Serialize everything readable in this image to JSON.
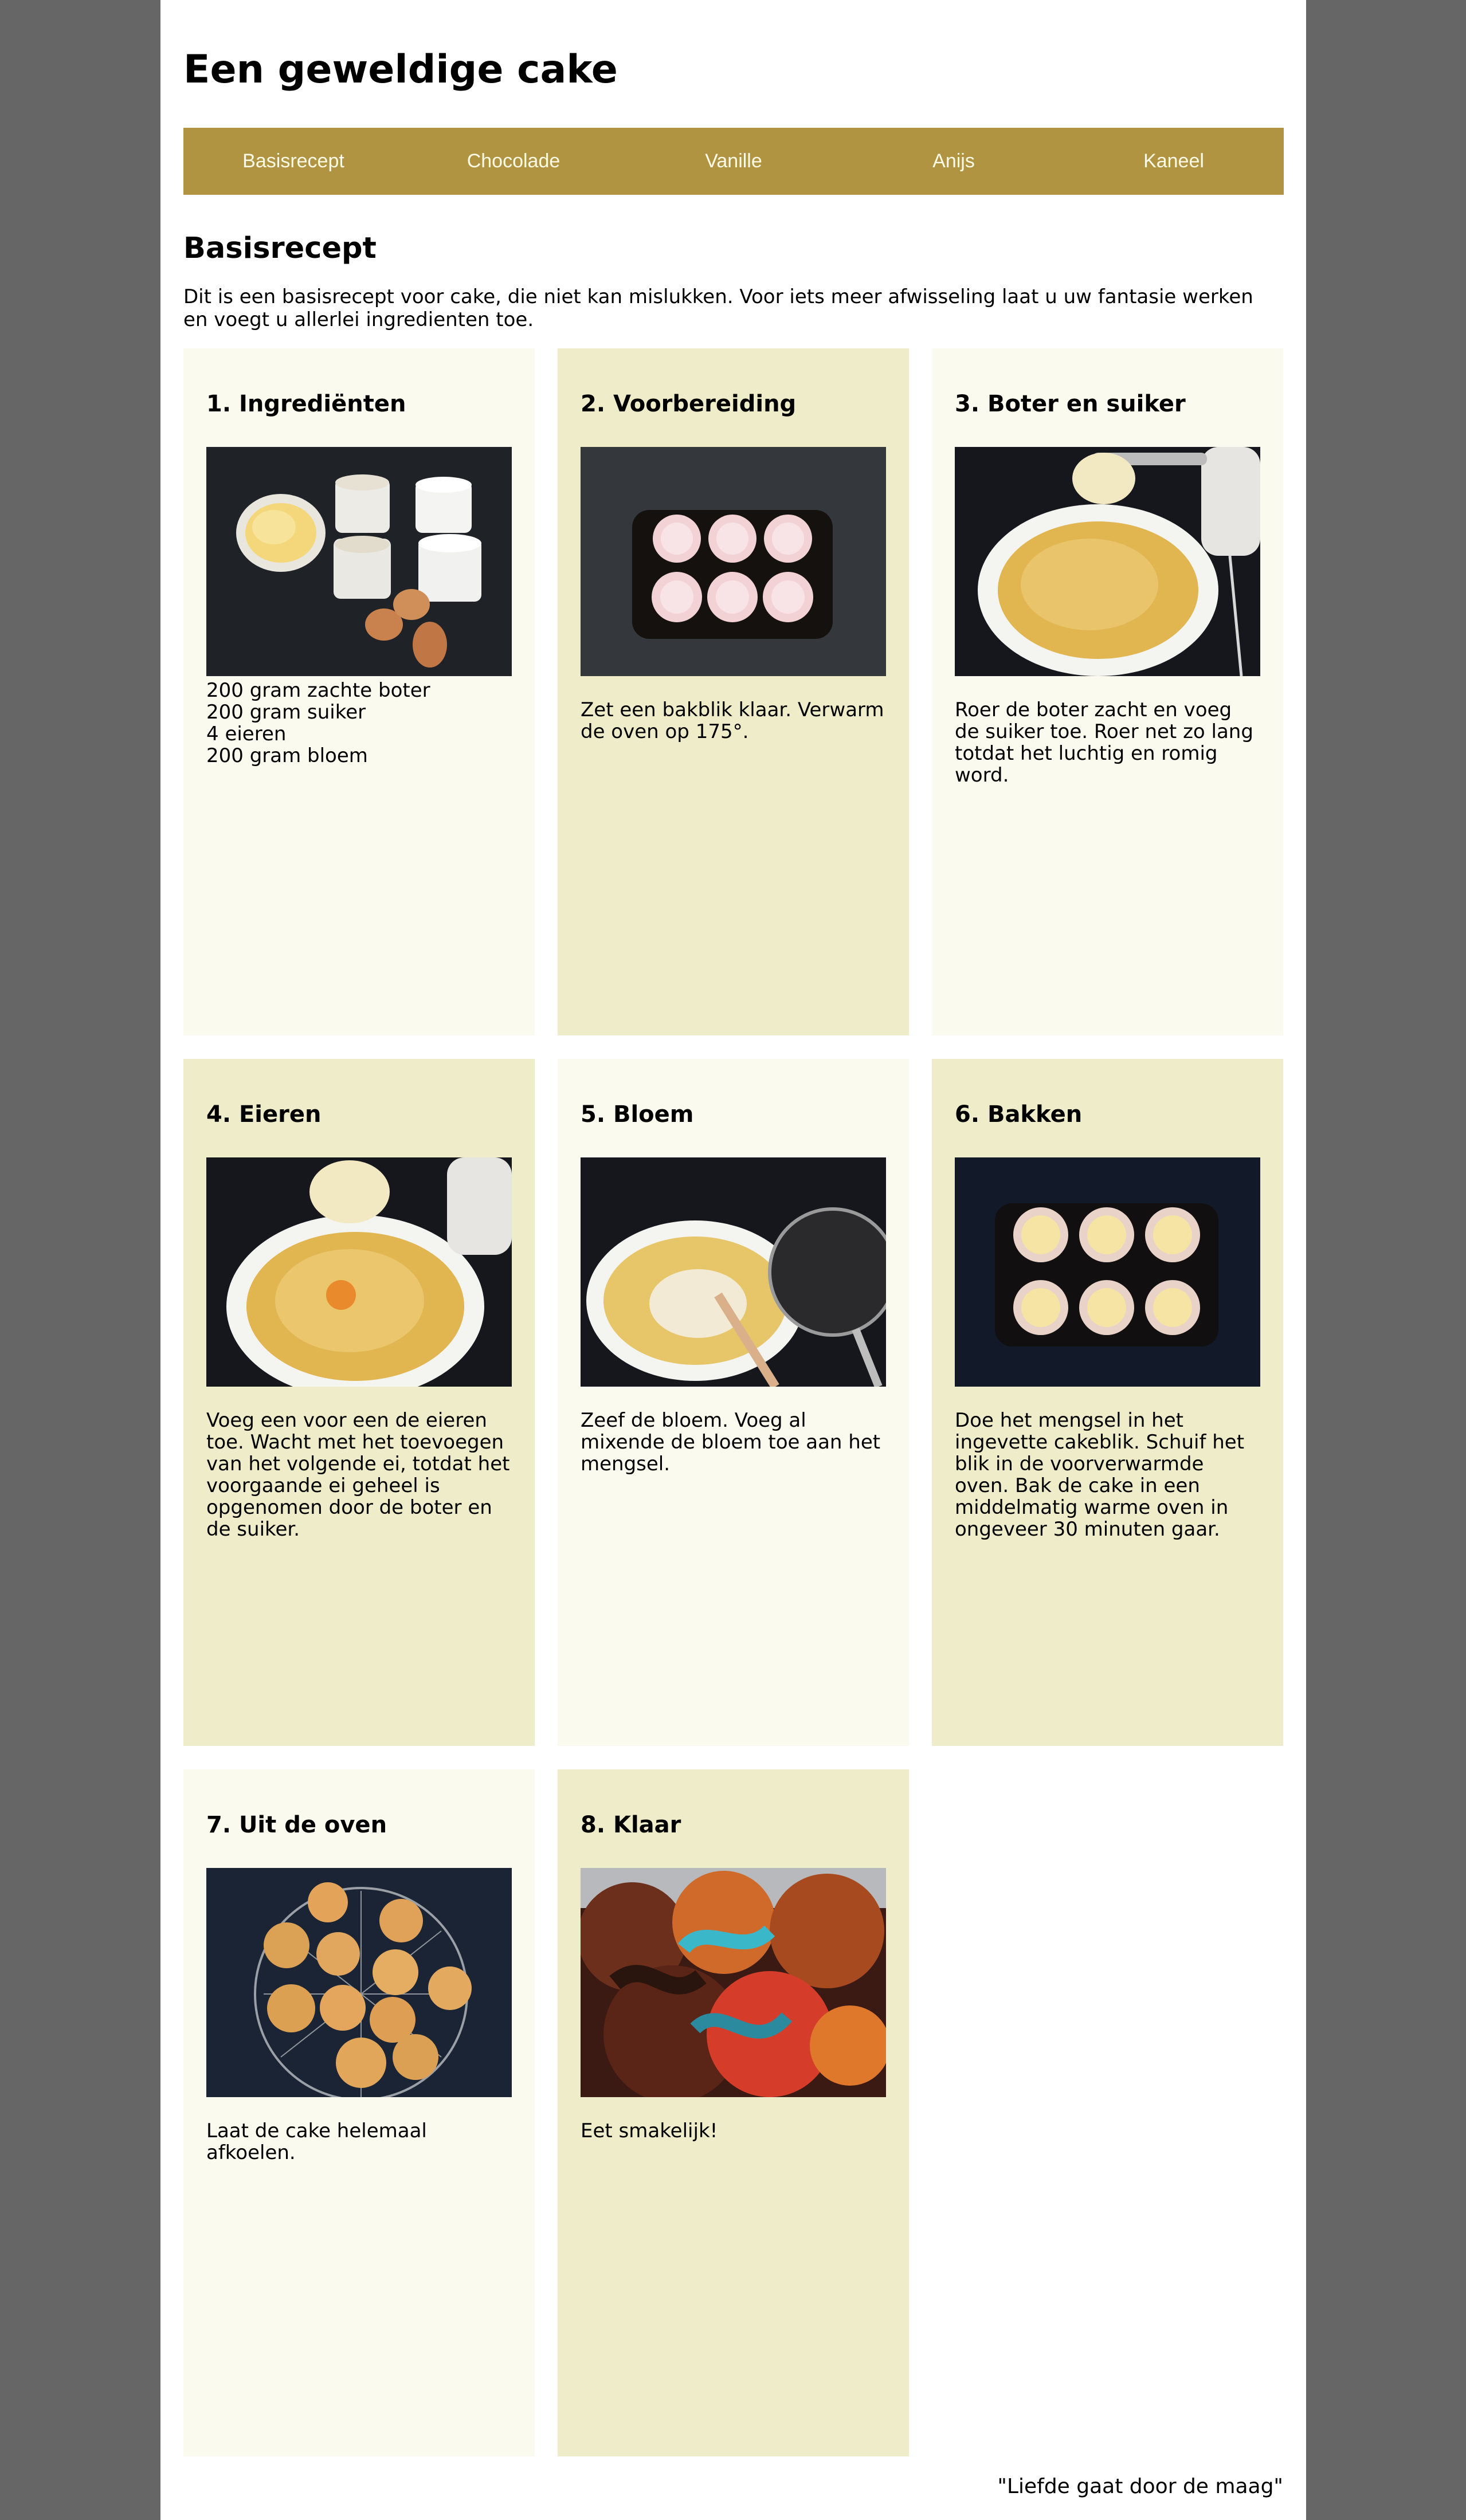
{
  "site": {
    "title": "Een geweldige cake"
  },
  "nav": {
    "items": [
      {
        "label": "Basisrecept"
      },
      {
        "label": "Chocolade"
      },
      {
        "label": "Vanille"
      },
      {
        "label": "Anijs"
      },
      {
        "label": "Kaneel"
      }
    ]
  },
  "section": {
    "title": "Basisrecept",
    "intro": "Dit is een basisrecept voor cake, die niet kan mislukken. Voor iets meer afwisseling laat u uw fantasie werken en voegt u allerlei ingredienten toe."
  },
  "steps": [
    {
      "title": "1. Ingrediënten",
      "image": "ingredients-photo",
      "lines": [
        "200 gram zachte boter",
        "200 gram suiker",
        "4 eieren",
        "200 gram bloem"
      ]
    },
    {
      "title": "2. Voorbereiding",
      "image": "baking-tin-photo",
      "text": "Zet een bakblik klaar. Verwarm de oven op 175°."
    },
    {
      "title": "3. Boter en suiker",
      "image": "butter-sugar-mixing-photo",
      "text": "Roer de boter zacht en voeg de suiker toe. Roer net zo lang totdat het luchtig en romig word."
    },
    {
      "title": "4. Eieren",
      "image": "egg-mixing-photo",
      "text": "Voeg een voor een de eieren toe. Wacht met het toevoegen van het volgende ei, totdat het voorgaande ei geheel is opgenomen door de boter en de suiker."
    },
    {
      "title": "5. Bloem",
      "image": "flour-sieve-photo",
      "text": "Zeef de bloem. Voeg al mixende de bloem toe aan het mengsel."
    },
    {
      "title": "6. Bakken",
      "image": "filled-tin-photo",
      "text": "Doe het mengsel in het ingevette cakeblik. Schuif het blik in de voorverwarmde oven. Bak de cake in een middelmatig warme oven in ongeveer 30 minuten gaar."
    },
    {
      "title": "7. Uit de oven",
      "image": "cooling-rack-photo",
      "text": "Laat de cake helemaal afkoelen."
    },
    {
      "title": "8. Klaar",
      "image": "decorated-cupcakes-photo",
      "text": "Eet smakelijk!"
    }
  ],
  "footer": {
    "quote": "\"Liefde gaat door de maag\""
  },
  "colors": {
    "background": "#666666",
    "page": "#ffffff",
    "nav": "#b09442",
    "nav_text": "#fffbe6",
    "card_light": "#fafaee",
    "card_dark": "#efecc9"
  }
}
